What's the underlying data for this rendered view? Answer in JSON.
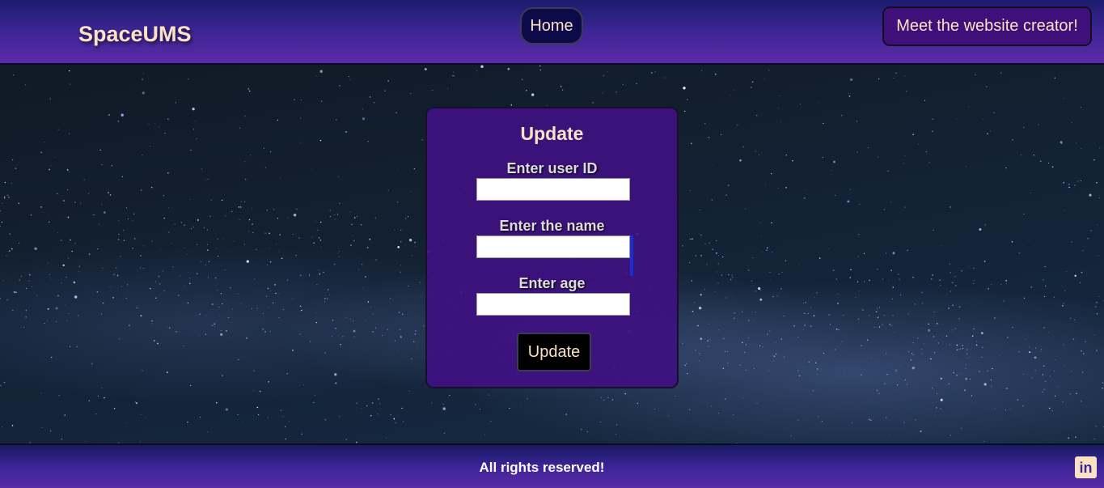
{
  "header": {
    "logo": "SpaceUMS",
    "nav_home": "Home",
    "creator_button": "Meet the website creator!"
  },
  "form": {
    "title": "Update",
    "user_id_label": "Enter user ID",
    "user_id_value": "",
    "name_label": "Enter the name",
    "name_value": "",
    "age_label": "Enter age",
    "age_value": "",
    "submit_label": "Update"
  },
  "footer": {
    "text": "All rights reserved!",
    "social_icon": "linkedin-icon",
    "social_glyph": "in"
  },
  "colors": {
    "accent_text": "#fbe2c3",
    "header_purple": "#5b2aa8",
    "card_purple": "#3e1080"
  }
}
